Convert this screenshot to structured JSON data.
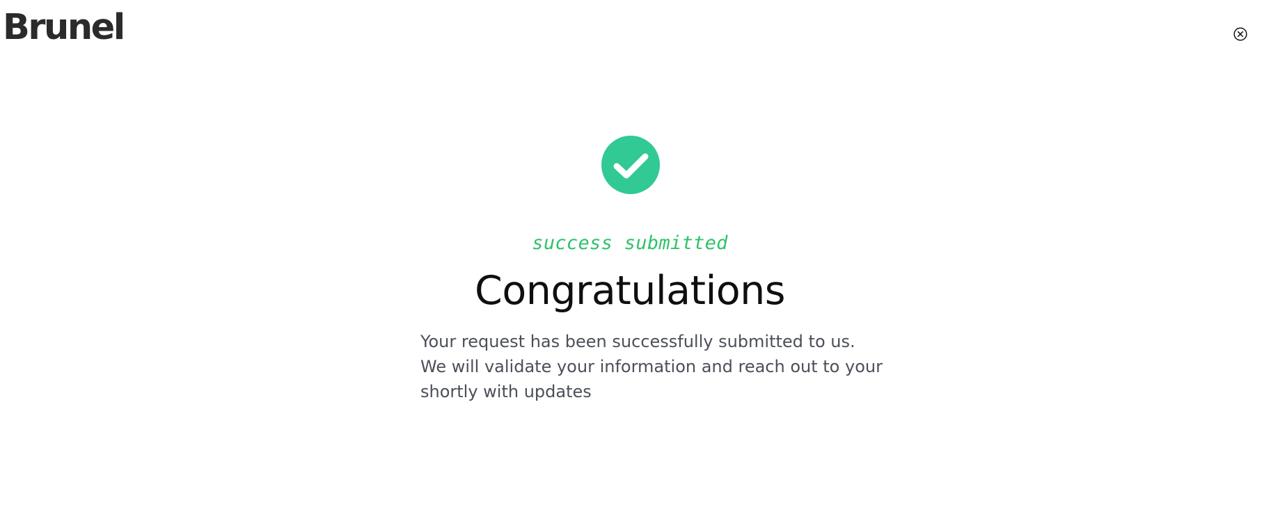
{
  "header": {
    "logo_text": "Brunel",
    "close_icon": "close-circle-icon"
  },
  "success": {
    "icon": "check-circle-icon",
    "accent_color": "#31c994",
    "label": "success submitted",
    "label_color": "#2fc26a",
    "title": "Congratulations",
    "message_lines": [
      "Your request has been successfully submitted to us.",
      "We will validate your information and reach out to your",
      "shortly with updates"
    ]
  }
}
